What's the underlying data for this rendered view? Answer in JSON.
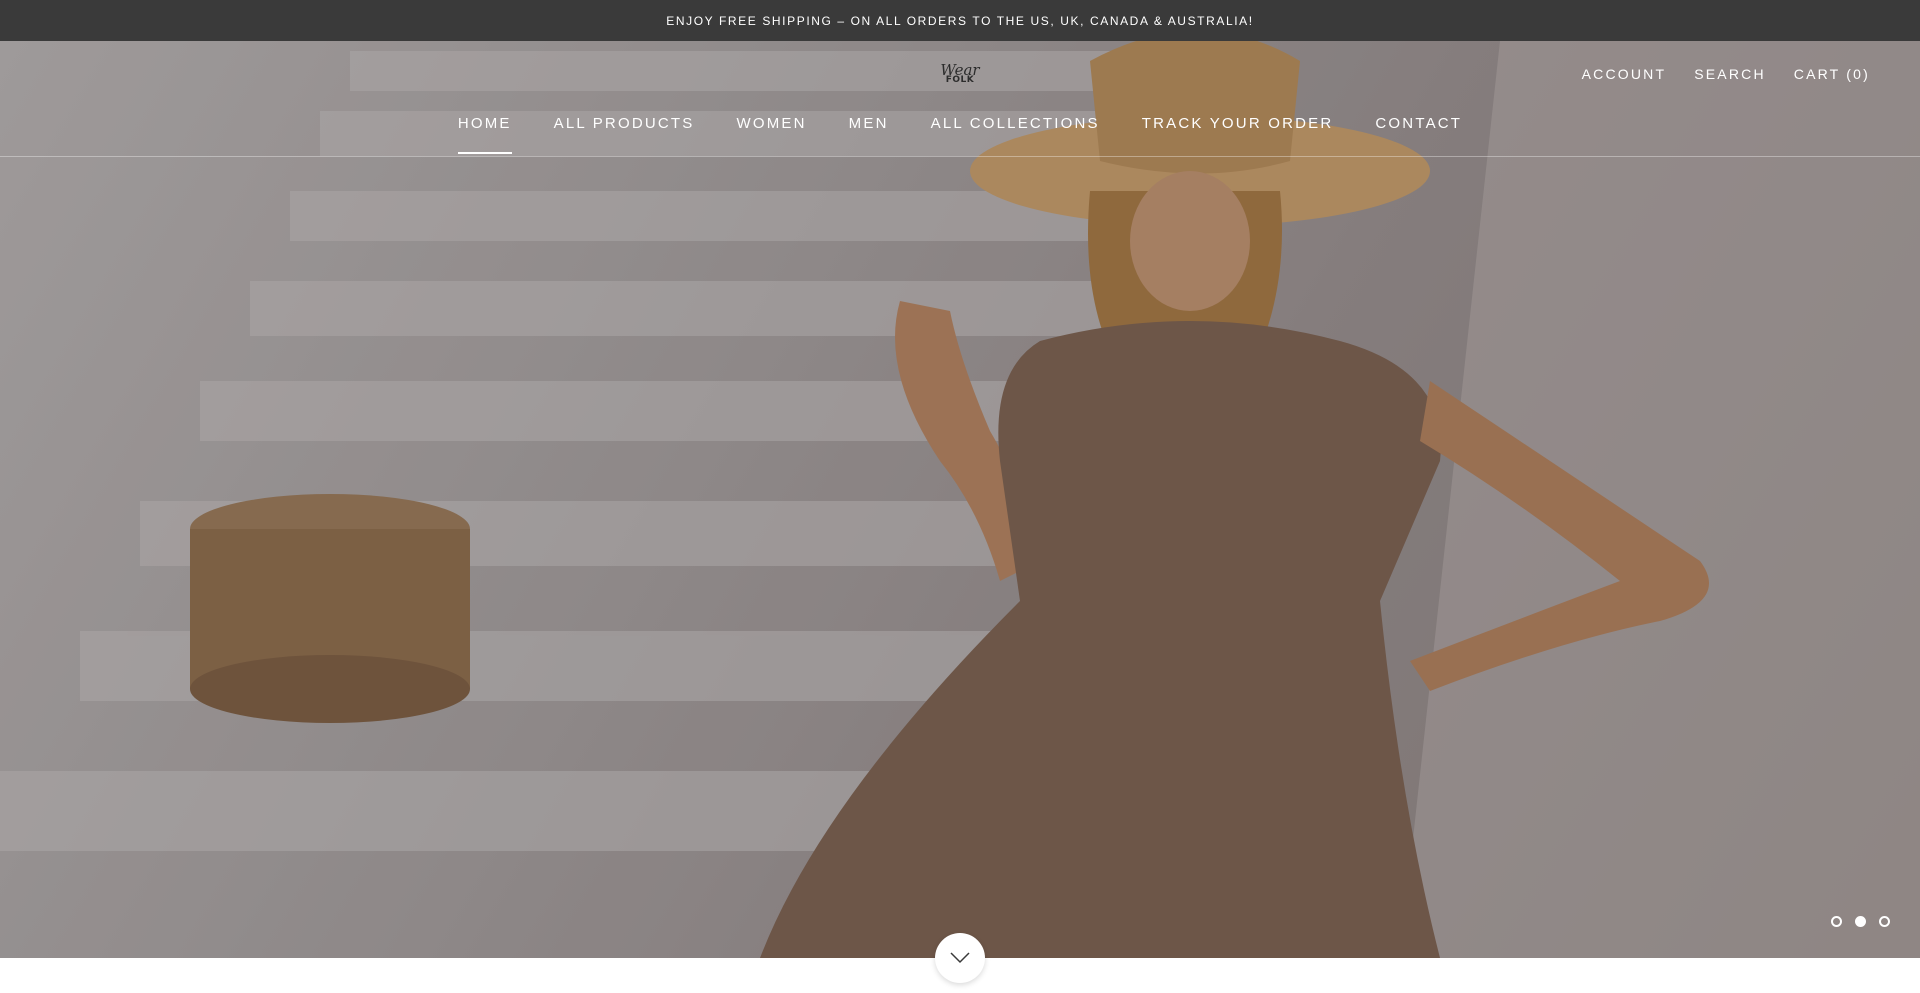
{
  "announcement": {
    "text": "ENJOY FREE SHIPPING – ON ALL ORDERS TO THE US, UK, CANADA & AUSTRALIA!"
  },
  "header": {
    "logo": {
      "line1": "Wear",
      "line2": "FOLK"
    },
    "top_links": {
      "account": "ACCOUNT",
      "search": "SEARCH",
      "cart": "CART (0)"
    },
    "nav": [
      {
        "label": "HOME",
        "active": true
      },
      {
        "label": "ALL PRODUCTS"
      },
      {
        "label": "WOMEN"
      },
      {
        "label": "MEN"
      },
      {
        "label": "ALL COLLECTIONS"
      },
      {
        "label": "TRACK YOUR ORDER"
      },
      {
        "label": "CONTACT"
      }
    ]
  },
  "hero": {
    "slideshow": {
      "slide_count": 3,
      "active_slide": 2
    },
    "scroll_icon": "chevron-down-icon"
  },
  "colors": {
    "announcement_bg": "#3a3a3a",
    "text_light": "#ffffff"
  }
}
